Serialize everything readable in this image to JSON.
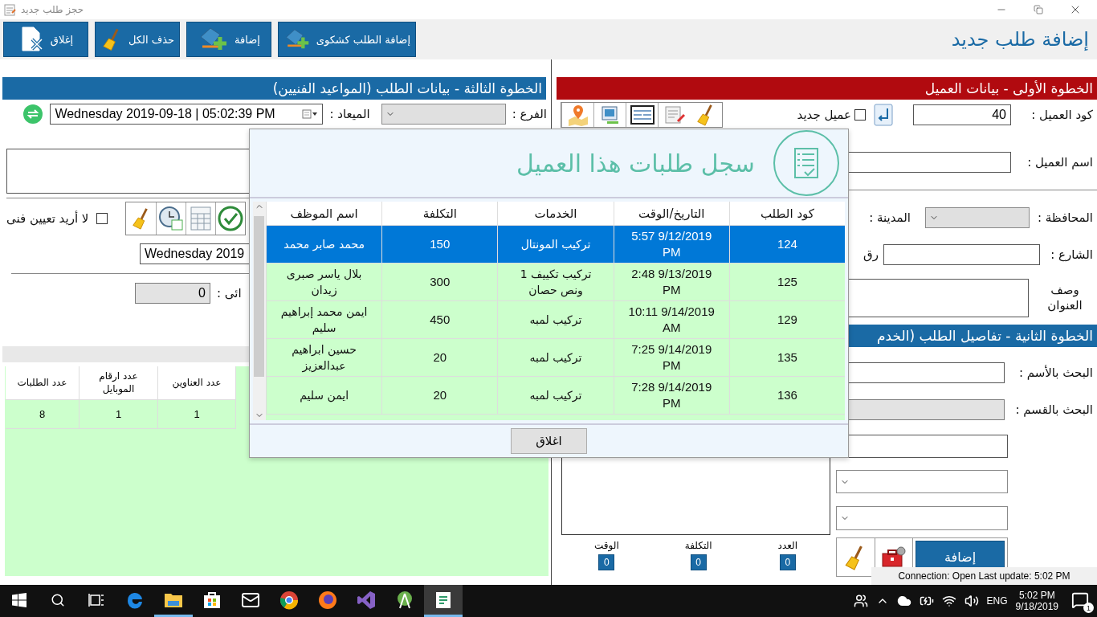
{
  "window": {
    "title": "حجز طلب جديد"
  },
  "toolbar": {
    "buttons": [
      {
        "kind": "complaint",
        "label": "إضافة الطلب كشكوى"
      },
      {
        "kind": "add",
        "label": "إضافة"
      },
      {
        "kind": "clear",
        "label": "حذف الكل"
      },
      {
        "kind": "close",
        "label": "إغلاق"
      }
    ],
    "page_title": "إضافة طلب جديد"
  },
  "step3": {
    "title": "الخطوة الثالثة - بيانات الطلب (المواعيد  الفنيين)",
    "branch_label": "الفرع :",
    "appointment_label": "الميعاد :",
    "appointment": "Wednesday 2019-09-18 | 05:02:39  PM",
    "no_technician": {
      "label": "لا أريد تعيين فنى",
      "checked": false
    },
    "date": "Wednesday 2019",
    "total_label": "ائى :",
    "total": "0",
    "stats": {
      "columns": [
        "عدد العناوين",
        "عدد ارقام الموبايل",
        "عدد الطلبات"
      ],
      "rows": [
        [
          "1",
          "1",
          "8"
        ]
      ]
    }
  },
  "step1": {
    "title": "الخطوة الأولى - بيانات العميل",
    "code_label": "كود العميل :",
    "code": "40",
    "new_customer": {
      "label": "عميل جديد",
      "checked": false
    },
    "name_label": "اسم العميل :",
    "governorate_label": "المحافظة :",
    "city_label": "المدينة :",
    "street_label": "الشارع :",
    "number_label": "رق",
    "address_label": "وصف العنوان"
  },
  "step2": {
    "title": "الخطوة الثانية  - تفاصيل الطلب (الخدم",
    "search_name_label": "البحث بالأسم :",
    "search_section_label": "البحث بالقسم :",
    "add_button": "إضافة",
    "totals": [
      {
        "label": "العدد",
        "value": "0"
      },
      {
        "label": "التكلفة",
        "value": "0"
      },
      {
        "label": "الوقت",
        "value": "0"
      }
    ]
  },
  "dialog": {
    "title": "سجل طلبات هذا العميل",
    "columns": [
      "كود الطلب",
      "التاريخ/الوقت",
      "الخدمات",
      "التكلفة",
      "اسم الموظف"
    ],
    "rows": [
      {
        "code": "124",
        "datetime": "5:57 9/12/2019 PM",
        "services": "تركيب المونتال",
        "cost": "150",
        "employee": "محمد صابر محمد",
        "selected": true
      },
      {
        "code": "125",
        "datetime": "2:48 9/13/2019 PM",
        "services": "تركيب تكييف 1 ونص حصان",
        "cost": "300",
        "employee": "بلال ياسر صبرى زيدان",
        "selected": false
      },
      {
        "code": "129",
        "datetime": "10:11 9/14/2019 AM",
        "services": "تركيب لمبه",
        "cost": "450",
        "employee": "ايمن محمد إبراهيم سليم",
        "selected": false
      },
      {
        "code": "135",
        "datetime": "7:25 9/14/2019 PM",
        "services": "تركيب لمبه",
        "cost": "20",
        "employee": "حسين ابراهيم عبدالعزيز",
        "selected": false
      },
      {
        "code": "136",
        "datetime": "7:28 9/14/2019 PM",
        "services": "تركيب لمبه",
        "cost": "20",
        "employee": "ايمن سليم",
        "selected": false
      }
    ],
    "close_button": "اغلاق"
  },
  "status": "Connection: Open Last update: 5:02 PM",
  "taskbar": {
    "apps": [
      {
        "kind": "edge",
        "running": false,
        "active": false
      },
      {
        "kind": "explorer",
        "running": true,
        "active": false
      },
      {
        "kind": "store",
        "running": false,
        "active": false
      },
      {
        "kind": "mail",
        "running": false,
        "active": false
      },
      {
        "kind": "chrome",
        "running": false,
        "active": false
      },
      {
        "kind": "firefox",
        "running": false,
        "active": false
      },
      {
        "kind": "vs",
        "running": false,
        "active": false
      },
      {
        "kind": "android",
        "running": false,
        "active": false
      },
      {
        "kind": "app",
        "running": true,
        "active": true
      }
    ],
    "language": "ENG",
    "time": "5:02 PM",
    "date": "9/18/2019",
    "notifications": "1"
  }
}
